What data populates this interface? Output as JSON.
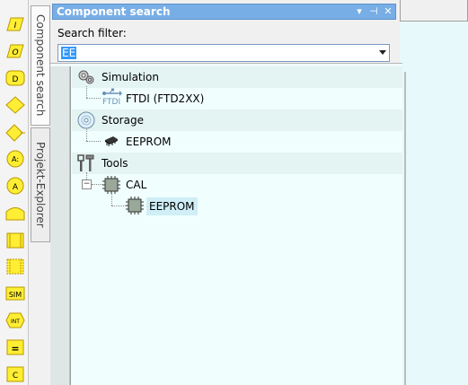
{
  "panel": {
    "title": "Component search",
    "search_label": "Search filter:",
    "search_value": "EE"
  },
  "side_tabs": {
    "component_search": "Component search",
    "project_explorer": "Projekt-Explorer"
  },
  "toolbar": {
    "labels": [
      "D",
      "A:",
      "A",
      "SIM",
      "INT",
      "=",
      "C"
    ]
  },
  "tree": [
    {
      "label": "Simulation",
      "icon": "gears-icon",
      "children": [
        {
          "label": "FTDI (FTD2XX)",
          "icon_caption": "FTDI",
          "icon": "usb-icon"
        }
      ]
    },
    {
      "label": "Storage",
      "icon": "disc-icon",
      "children": [
        {
          "label": "EEPROM",
          "icon": "chip-icon"
        }
      ]
    },
    {
      "label": "Tools",
      "icon": "tools-icon",
      "children": [
        {
          "label": "CAL",
          "icon": "chip-frame-icon",
          "expander": "⊟",
          "children": [
            {
              "label": "EEPROM",
              "icon": "chip-frame-icon",
              "selected": true
            }
          ]
        }
      ]
    }
  ],
  "colors": {
    "title_bar": "#78aee6",
    "flowchart_fill": "#ffee33",
    "flowchart_stroke": "#b89800",
    "selection": "#cfeef6"
  }
}
